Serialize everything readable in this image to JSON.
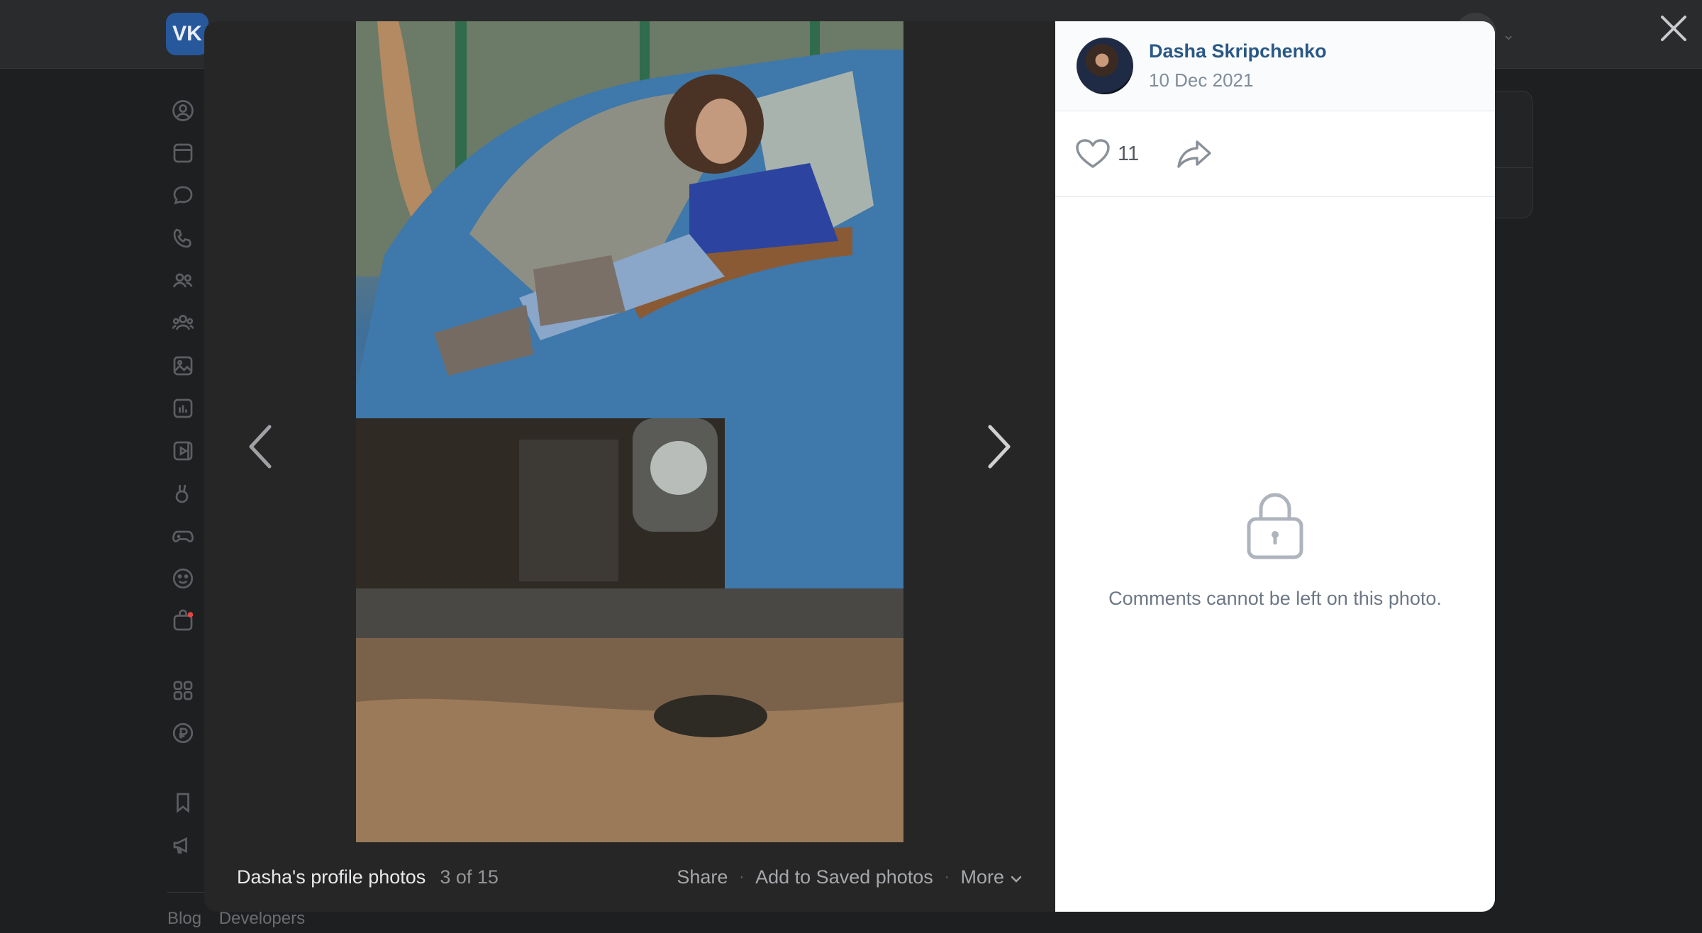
{
  "viewer": {
    "album_title": "Dasha's profile photos",
    "counter": "3 of 15",
    "actions": {
      "share": "Share",
      "save": "Add to Saved photos",
      "more": "More"
    }
  },
  "post": {
    "author_name": "Dasha Skripchenko",
    "date": "10 Dec 2021",
    "likes": "11",
    "comments_locked_message": "Comments cannot be left on this photo."
  },
  "background": {
    "footer_links": [
      "Blog",
      "Developers"
    ]
  },
  "colors": {
    "author_link": "#2a5885",
    "muted_text": "#818c99",
    "viewer_bg": "#262626",
    "overlay_bg": "#1e1f21"
  }
}
